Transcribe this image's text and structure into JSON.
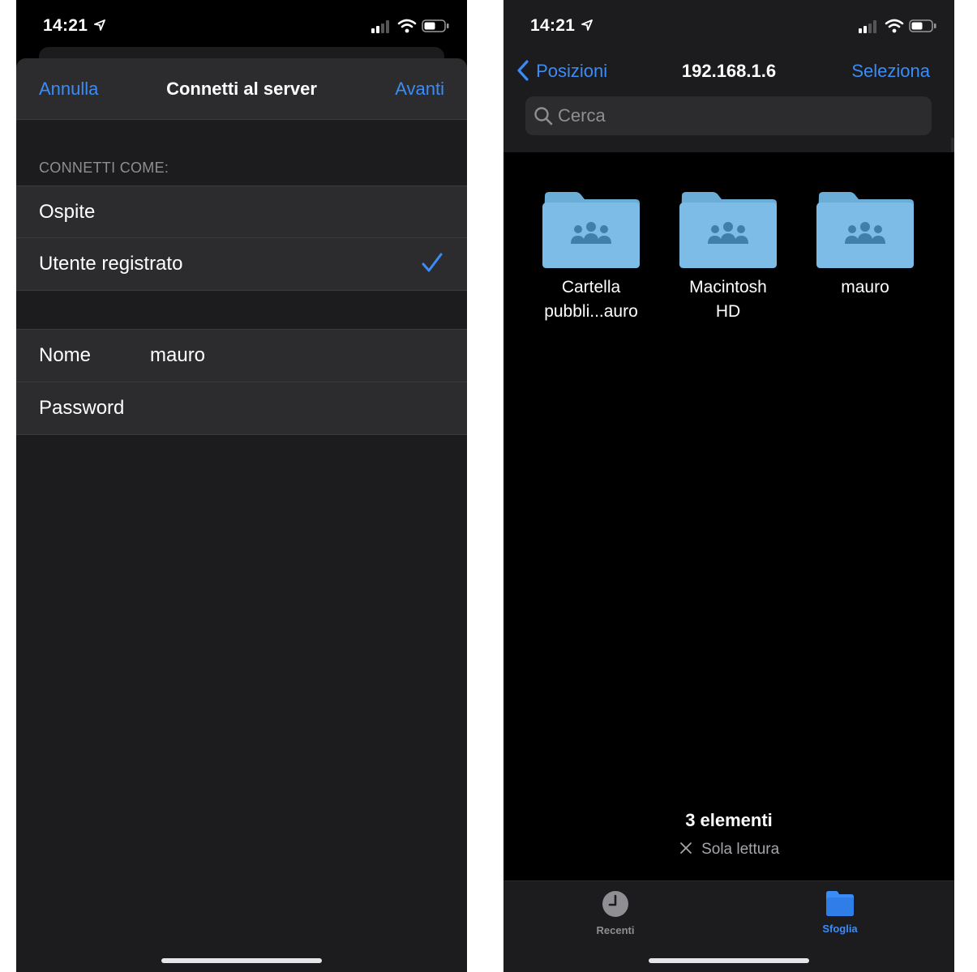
{
  "left": {
    "status": {
      "time": "14:21"
    },
    "nav": {
      "cancel": "Annulla",
      "title": "Connetti al server",
      "next": "Avanti"
    },
    "section_header": "CONNETTI COME:",
    "options": [
      {
        "label": "Ospite",
        "selected": false
      },
      {
        "label": "Utente registrato",
        "selected": true
      }
    ],
    "fields": [
      {
        "label": "Nome",
        "value": "mauro"
      },
      {
        "label": "Password",
        "value": ""
      }
    ]
  },
  "right": {
    "status": {
      "time": "14:21"
    },
    "nav": {
      "back": "Posizioni",
      "title": "192.168.1.6",
      "select": "Seleziona"
    },
    "search": {
      "placeholder": "Cerca"
    },
    "folders": [
      {
        "line1": "Cartella",
        "line2": "pubbli...auro"
      },
      {
        "line1": "Macintosh",
        "line2": "HD"
      },
      {
        "line1": "mauro",
        "line2": ""
      }
    ],
    "count": "3 elementi",
    "readonly": "Sola lettura",
    "tabs": [
      {
        "label": "Recenti",
        "icon": "clock-icon",
        "active": false
      },
      {
        "label": "Sfoglia",
        "icon": "folder-icon",
        "active": true
      }
    ]
  },
  "colors": {
    "accent": "#3a8cf7",
    "folder": "#7cbce6",
    "background": "#000000",
    "sheet": "#1c1c1e",
    "cell": "#2c2c2e"
  }
}
